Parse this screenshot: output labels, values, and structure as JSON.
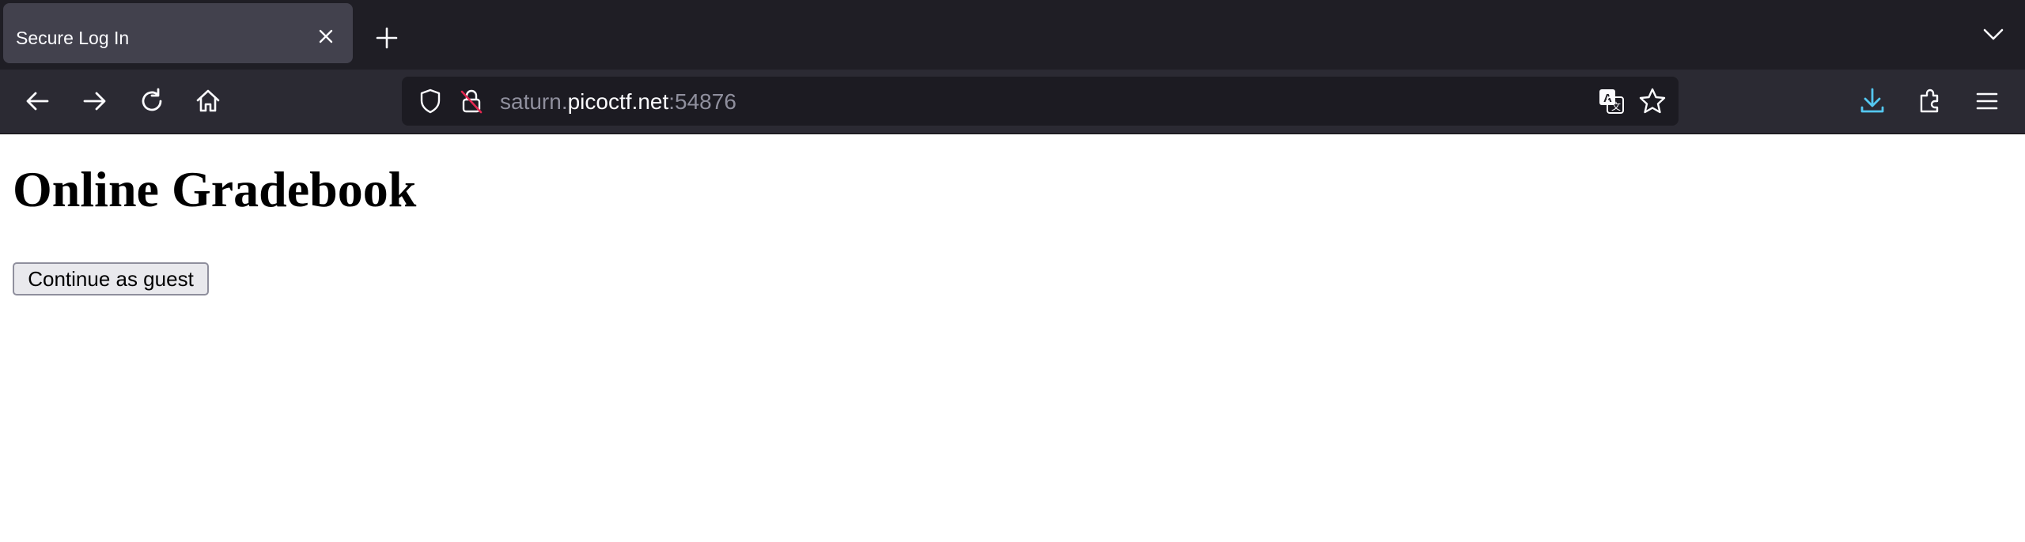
{
  "browser": {
    "tab": {
      "title": "Secure Log In",
      "close_icon": "close-icon"
    },
    "new_tab_icon": "plus-icon",
    "tab_list_icon": "chevron-down-icon",
    "nav": {
      "back_icon": "arrow-left-icon",
      "forward_icon": "arrow-right-icon",
      "reload_icon": "reload-icon",
      "home_icon": "home-icon"
    },
    "url": {
      "subdomain": "saturn.",
      "host": "picoctf.net",
      "port": ":54876",
      "shield_icon": "shield-icon",
      "insecure_lock_icon": "insecure-lock-icon",
      "translate_icon": "translate-icon",
      "bookmark_icon": "star-icon"
    },
    "toolbar": {
      "downloads_icon": "download-icon",
      "extensions_icon": "puzzle-icon",
      "menu_icon": "hamburger-menu-icon"
    },
    "colors": {
      "tabbar": "#1f1e25",
      "active_tab": "#42414d",
      "navbar": "#2b2a33",
      "urlbar": "#1c1b22",
      "download_accent": "#54c7f0"
    }
  },
  "page": {
    "heading": "Online Gradebook",
    "guest_button": "Continue as guest"
  }
}
